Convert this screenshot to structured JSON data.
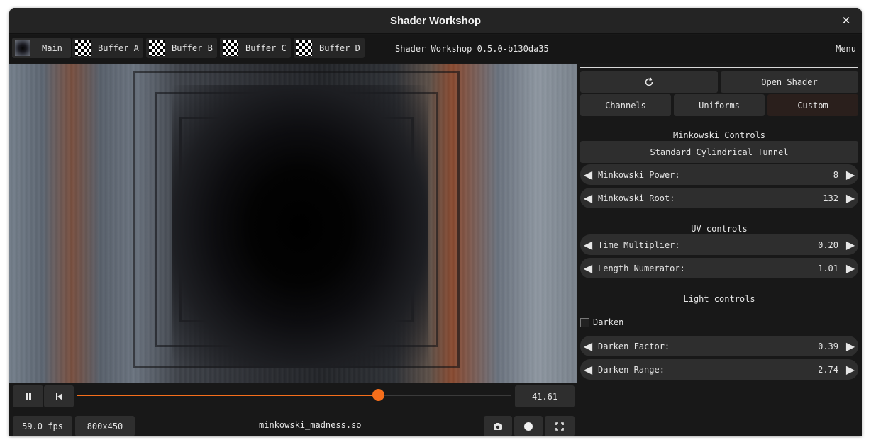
{
  "window": {
    "title": "Shader Workshop",
    "close_glyph": "✕"
  },
  "toolbar": {
    "tabs": [
      {
        "label": "Main",
        "thumb": "tunnel-thumbnail",
        "active": true
      },
      {
        "label": "Buffer A",
        "thumb": "checker-thumbnail"
      },
      {
        "label": "Buffer B",
        "thumb": "checker-thumbnail"
      },
      {
        "label": "Buffer C",
        "thumb": "checker-thumbnail"
      },
      {
        "label": "Buffer D",
        "thumb": "checker-thumbnail"
      }
    ],
    "version": "Shader Workshop 0.5.0-b130da35",
    "menu": "Menu"
  },
  "playback": {
    "play_pause_icon": "pause-icon",
    "restart_icon": "skip-to-start-icon",
    "progress": 0.695,
    "accent_color": "#f56e1b",
    "time": "41.61",
    "fps": "59.0 fps",
    "resolution": "800x450",
    "filename": "minkowski_madness.so",
    "screenshot_icon": "camera-icon",
    "record_icon": "record-icon",
    "fullscreen_icon": "fullscreen-icon"
  },
  "panel": {
    "reload_icon": "reload-icon",
    "open_shader": "Open Shader",
    "tabs": [
      {
        "label": "Channels"
      },
      {
        "label": "Uniforms"
      },
      {
        "label": "Custom",
        "selected": true
      }
    ],
    "minkowski": {
      "heading": "Minkowski Controls",
      "preset_button": "Standard Cylindrical Tunnel",
      "power": {
        "label": "Minkowski Power:",
        "value": "8"
      },
      "root": {
        "label": "Minkowski Root:",
        "value": "132"
      }
    },
    "uv": {
      "heading": "UV controls",
      "time_multiplier": {
        "label": "Time Multiplier:",
        "value": "0.20"
      },
      "length_numerator": {
        "label": "Length Numerator:",
        "value": "1.01"
      }
    },
    "light": {
      "heading": "Light controls",
      "darken": {
        "label": "Darken",
        "checked": false
      },
      "darken_factor": {
        "label": "Darken Factor:",
        "value": "0.39"
      },
      "darken_range": {
        "label": "Darken Range:",
        "value": "2.74"
      }
    },
    "arrow_left": "◀",
    "arrow_right": "▶"
  }
}
